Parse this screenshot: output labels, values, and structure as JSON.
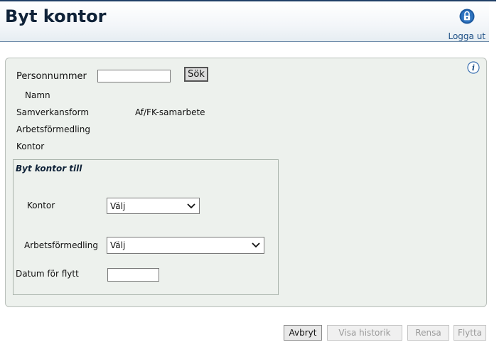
{
  "header": {
    "title": "Byt kontor",
    "logout_label": "Logga ut"
  },
  "form": {
    "personnummer_label": "Personnummer",
    "personnummer_value": "",
    "search_label": "Sök",
    "namn_label": "Namn",
    "samverkansform_label": "Samverkansform",
    "samverkansform_value": "Af/FK-samarbete",
    "arbetsformedling_label": "Arbetsförmedling",
    "kontor_label": "Kontor"
  },
  "change": {
    "legend": "Byt kontor till",
    "kontor_label": "Kontor",
    "kontor_selected": "Välj",
    "arbetsformedling_label": "Arbetsförmedling",
    "arbetsformedling_selected": "Välj",
    "datum_label": "Datum för flytt",
    "datum_value": ""
  },
  "actions": {
    "cancel": "Avbryt",
    "history": "Visa historik",
    "clear": "Rensa",
    "move": "Flytta"
  },
  "colors": {
    "panel_bg": "#edf1ed",
    "title": "#0f2238",
    "link": "#1d4f86",
    "icon": "#1d5aa0"
  }
}
